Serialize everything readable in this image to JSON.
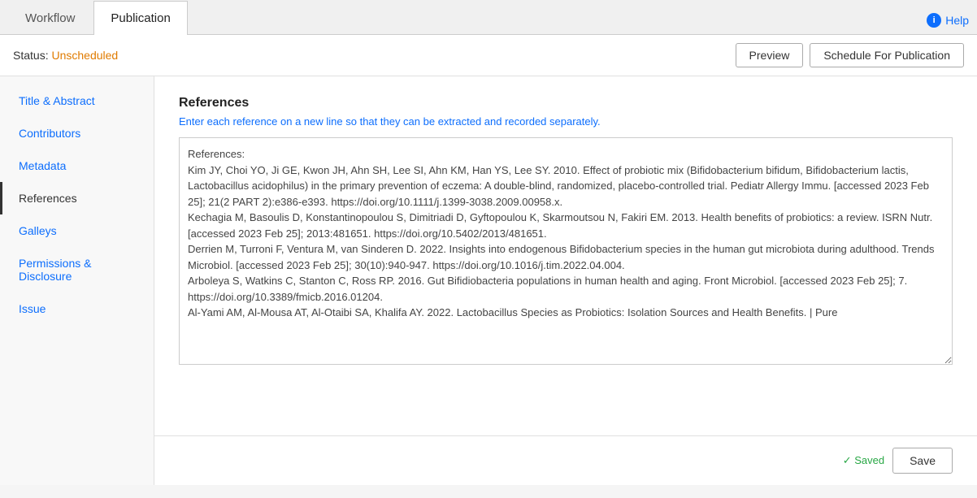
{
  "tabs": [
    {
      "id": "workflow",
      "label": "Workflow",
      "active": false
    },
    {
      "id": "publication",
      "label": "Publication",
      "active": true
    }
  ],
  "help": {
    "label": "Help"
  },
  "status": {
    "label": "Status:",
    "value": "Unscheduled"
  },
  "actions": {
    "preview": "Preview",
    "schedule": "Schedule For Publication"
  },
  "sidebar": {
    "items": [
      {
        "id": "title-abstract",
        "label": "Title & Abstract",
        "active": false
      },
      {
        "id": "contributors",
        "label": "Contributors",
        "active": false
      },
      {
        "id": "metadata",
        "label": "Metadata",
        "active": false
      },
      {
        "id": "references",
        "label": "References",
        "active": true
      },
      {
        "id": "galleys",
        "label": "Galleys",
        "active": false
      },
      {
        "id": "permissions-disclosure",
        "label": "Permissions & Disclosure",
        "active": false
      },
      {
        "id": "issue",
        "label": "Issue",
        "active": false
      }
    ]
  },
  "main": {
    "section_title": "References",
    "section_desc": "Enter each reference on a new line so that they can be extracted and recorded separately.",
    "references_content": "References:\nKim JY, Choi YO, Ji GE, Kwon JH, Ahn SH, Lee SI, Ahn KM, Han YS, Lee SY. 2010. Effect of probiotic mix (Bifidobacterium bifidum, Bifidobacterium lactis, Lactobacillus acidophilus) in the primary prevention of eczema: A double-blind, randomized, placebo-controlled trial. Pediatr Allergy Immu. [accessed 2023 Feb 25]; 21(2 PART 2):e386-e393. https://doi.org/10.1111/j.1399-3038.2009.00958.x.\nKechagia M, Basoulis D, Konstantinopoulou S, Dimitriadi D, Gyftopoulou K, Skarmoutsou N, Fakiri EM. 2013. Health benefits of probiotics: a review. ISRN Nutr. [accessed 2023 Feb 25]; 2013:481651. https://doi.org/10.5402/2013/481651.\nDerrien M, Turroni F, Ventura M, van Sinderen D. 2022. Insights into endogenous Bifidobacterium species in the human gut microbiota during adulthood. Trends Microbiol. [accessed 2023 Feb 25]; 30(10):940-947. https://doi.org/10.1016/j.tim.2022.04.004.\nArboleya S, Watkins C, Stanton C, Ross RP. 2016. Gut Bifidiobacteria populations in human health and aging. Front Microbiol. [accessed 2023 Feb 25]; 7. https://doi.org/10.3389/fmicb.2016.01204.\nAl-Yami AM, Al-Mousa AT, Al-Otaibi SA, Khalifa AY. 2022. Lactobacillus Species as Probiotics: Isolation Sources and Health Benefits. | Pure"
  },
  "footer": {
    "saved_label": "✓ Saved",
    "save_button": "Save"
  }
}
